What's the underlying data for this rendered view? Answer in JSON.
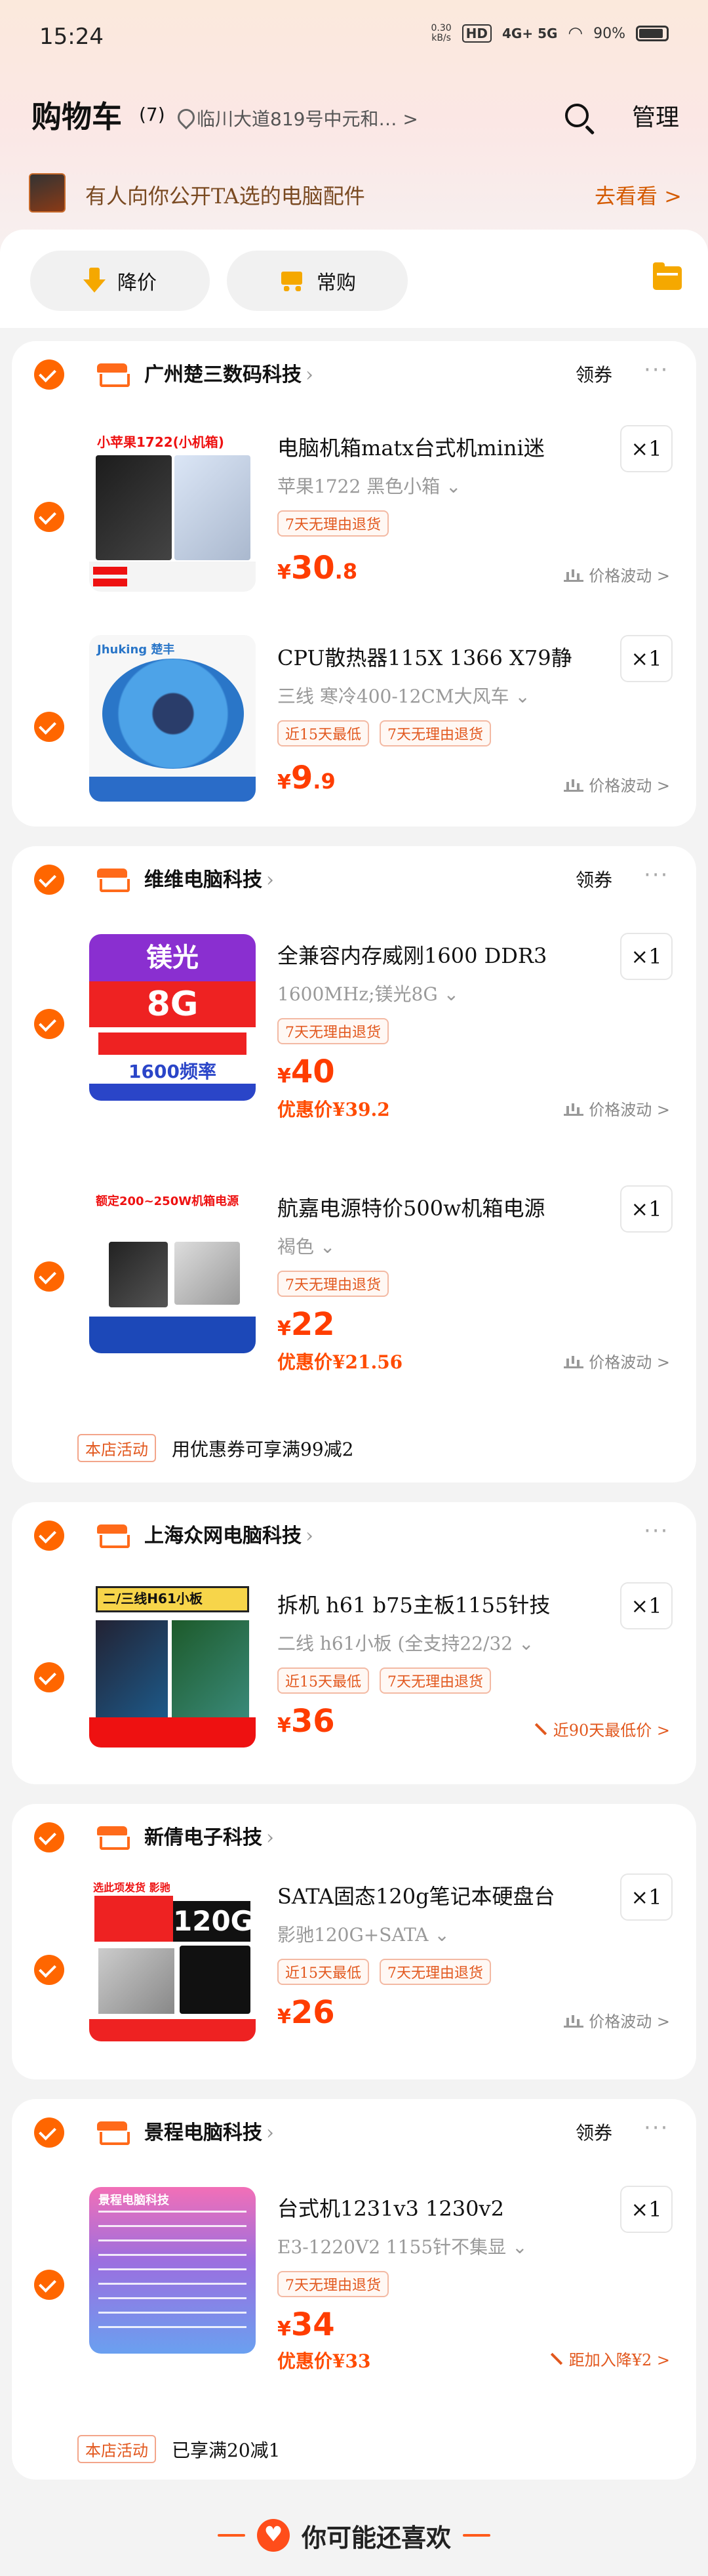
{
  "status": {
    "time": "15:24",
    "speed_top": "0.30",
    "speed_bottom": "kB/s",
    "hd": "HD",
    "net": "4G+ 5G",
    "battery": "90%"
  },
  "header": {
    "title": "购物车",
    "count": "(7)",
    "location": "临川大道819号中元和… >",
    "manage": "管理"
  },
  "promo": {
    "text": "有人向你公开TA选的电脑配件",
    "link": "去看看 >"
  },
  "sortbar": {
    "price_down": "降价",
    "frequent": "常购"
  },
  "shops": [
    {
      "name": "广州楚三数码科技",
      "coupon": "领券",
      "more": "···",
      "items": [
        {
          "title": "电脑机箱matx台式机mini迷",
          "spec": "苹果1722 黑色小箱 ⌄",
          "tags": [
            "7天无理由退货"
          ],
          "price_sym": "¥",
          "price_int": "30",
          "price_dec": ".8",
          "trend": "价格波动 >",
          "qty": "×1",
          "image_label": "小苹果1722(小机箱)"
        },
        {
          "title": "CPU散热器115X 1366 X79静",
          "spec": "三线 寒冷400-12CM大风车 ⌄",
          "tags": [
            "近15天最低",
            "7天无理由退货"
          ],
          "price_sym": "¥",
          "price_int": "9",
          "price_dec": ".9",
          "trend": "价格波动 >",
          "qty": "×1",
          "image_label": "Jhuking 楚丰"
        }
      ]
    },
    {
      "name": "维维电脑科技",
      "coupon": "领券",
      "more": "···",
      "items": [
        {
          "title": "全兼容内存威刚1600 DDR3",
          "spec": "1600MHz;镁光8G ⌄",
          "tags": [
            "7天无理由退货"
          ],
          "price_sym": "¥",
          "price_int": "40",
          "price_dec": "",
          "discount": "优惠价¥39.2",
          "trend": "价格波动 >",
          "qty": "×1",
          "image_top": "镁光",
          "image_big": "8G",
          "image_freq": "1600频率"
        },
        {
          "title": "航嘉电源特价500w机箱电源",
          "spec": "褐色 ⌄",
          "tags": [
            "7天无理由退货"
          ],
          "price_sym": "¥",
          "price_int": "22",
          "price_dec": "",
          "discount": "优惠价¥21.56",
          "trend": "价格波动 >",
          "qty": "×1",
          "image_label": "额定200~250W机箱电源"
        }
      ],
      "activity": {
        "tag": "本店活动",
        "text": "用优惠券可享满99减2"
      }
    },
    {
      "name": "上海众网电脑科技",
      "more": "···",
      "items": [
        {
          "title": "拆机 h61 b75主板1155针技",
          "spec": "二线 h61小板 (全支持22/32 ⌄",
          "tags": [
            "近15天最低",
            "7天无理由退货"
          ],
          "price_sym": "¥",
          "price_int": "36",
          "price_dec": "",
          "trend": "近90天最低价 >",
          "qty": "×1",
          "image_label": "二/三线H61小板"
        }
      ]
    },
    {
      "name": "新倩电子科技",
      "more": "",
      "items": [
        {
          "title": "SATA固态120g笔记本硬盘台",
          "spec": "影驰120G+SATA ⌄",
          "tags": [
            "近15天最低",
            "7天无理由退货"
          ],
          "price_sym": "¥",
          "price_int": "26",
          "price_dec": "",
          "trend": "价格波动 >",
          "qty": "×1",
          "image_label": "选此项发货 影驰",
          "image_cap": "120G"
        }
      ]
    },
    {
      "name": "景程电脑科技",
      "coupon": "领券",
      "more": "···",
      "items": [
        {
          "title": "台式机1231v3 1230v2",
          "spec": "E3-1220V2 1155针不集显 ⌄",
          "tags": [
            "7天无理由退货"
          ],
          "price_sym": "¥",
          "price_int": "34",
          "price_dec": "",
          "discount": "优惠价¥33",
          "trend": "距加入降¥2 >",
          "qty": "×1",
          "image_label": "景程电脑科技"
        }
      ],
      "activity": {
        "tag": "本店活动",
        "text": "已享满20减1"
      }
    }
  ],
  "footer": {
    "guess": "你可能还喜欢"
  },
  "colors": {
    "accent": "#ff6600",
    "price": "#ff3d00"
  }
}
